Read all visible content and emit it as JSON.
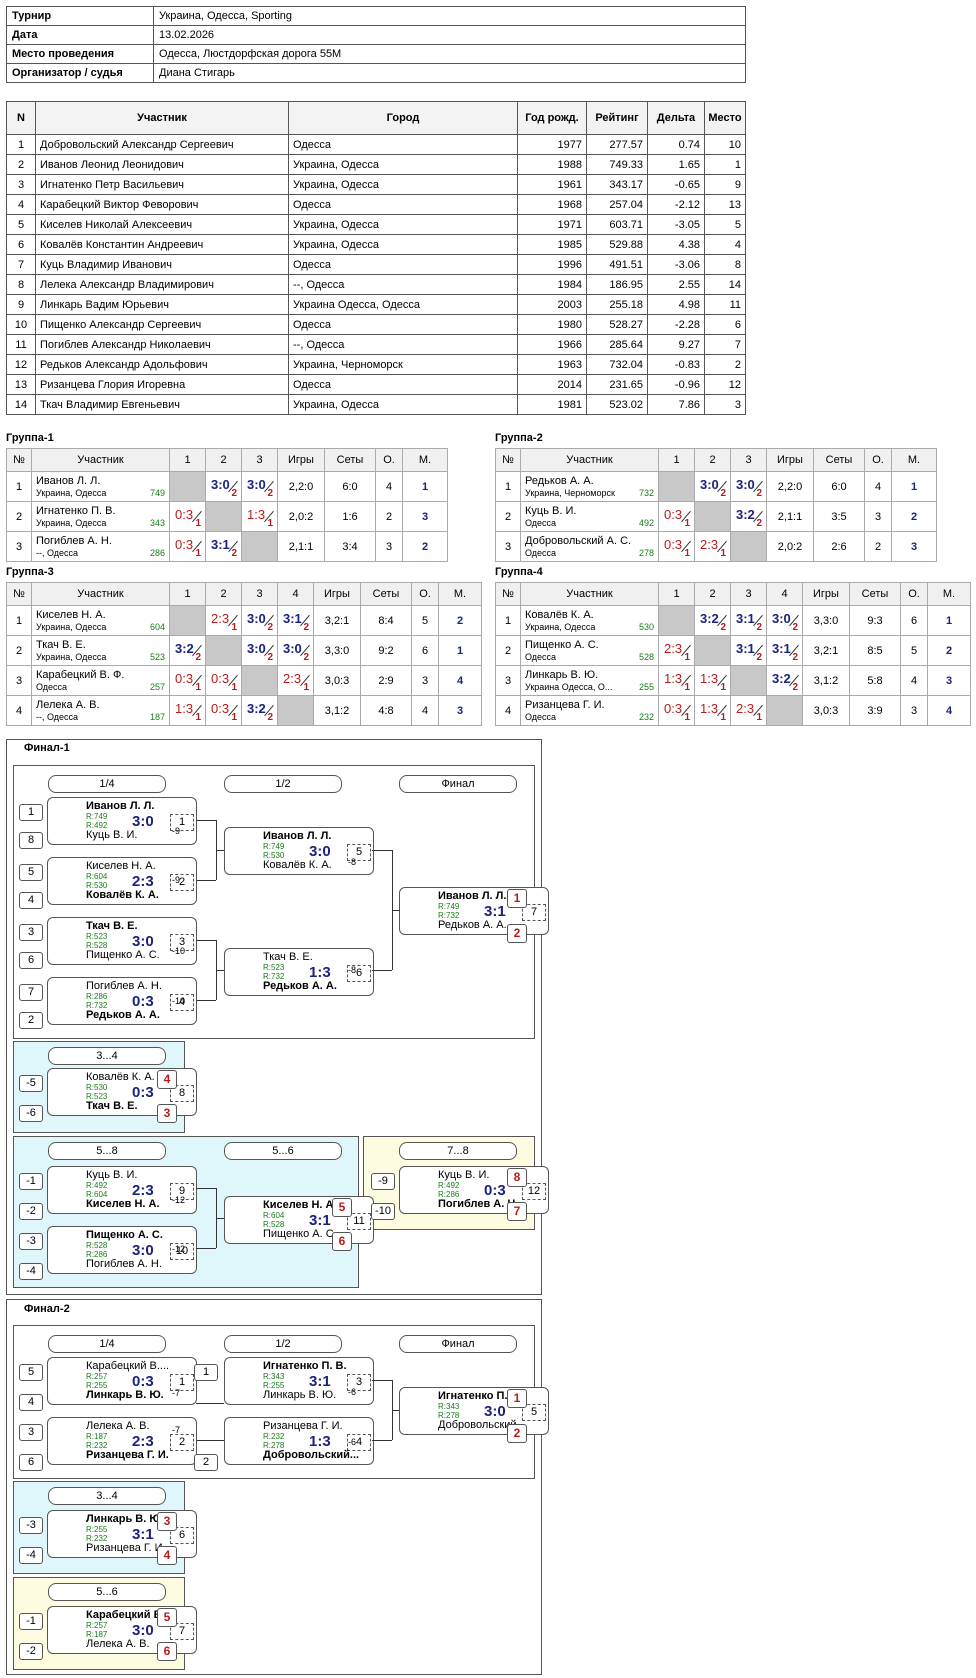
{
  "info": [
    {
      "k": "Турнир",
      "v": "Украина, Одесса, Sporting"
    },
    {
      "k": "Дата",
      "v": "13.02.2026"
    },
    {
      "k": "Место проведения",
      "v": "Одесса, Люстдорфская дорога 55М"
    },
    {
      "k": "Организатор / судья",
      "v": "Диана Стигарь"
    }
  ],
  "players_header": [
    "N",
    "Участник",
    "Город",
    "Год рожд.",
    "Рейтинг",
    "Дельта",
    "Место"
  ],
  "players": [
    [
      "1",
      "Добровольский Александр Сергеевич",
      "Одесса",
      "1977",
      "277.57",
      "0.74",
      "10"
    ],
    [
      "2",
      "Иванов Леонид Леонидович",
      "Украина, Одесса",
      "1988",
      "749.33",
      "1.65",
      "1"
    ],
    [
      "3",
      "Игнатенко Петр Васильевич",
      "Украина, Одесса",
      "1961",
      "343.17",
      "-0.65",
      "9"
    ],
    [
      "4",
      "Карабецкий Виктор Феворович",
      "Одесса",
      "1968",
      "257.04",
      "-2.12",
      "13"
    ],
    [
      "5",
      "Киселев Николай Алексеевич",
      "Украина, Одесса",
      "1971",
      "603.71",
      "-3.05",
      "5"
    ],
    [
      "6",
      "Ковалёв Константин Андреевич",
      "Украина, Одесса",
      "1985",
      "529.88",
      "4.38",
      "4"
    ],
    [
      "7",
      "Куць Владимир Иванович",
      "Одесса",
      "1996",
      "491.51",
      "-3.06",
      "8"
    ],
    [
      "8",
      "Лелека Александр Владимирович",
      "--, Одесса",
      "1984",
      "186.95",
      "2.55",
      "14"
    ],
    [
      "9",
      "Линкарь Вадим Юрьевич",
      "Украина Одесса, Одесса",
      "2003",
      "255.18",
      "4.98",
      "11"
    ],
    [
      "10",
      "Пищенко Александр Сергеевич",
      "Одесса",
      "1980",
      "528.27",
      "-2.28",
      "6"
    ],
    [
      "11",
      "Погиблев Александр Николаевич",
      "--, Одесса",
      "1966",
      "285.64",
      "9.27",
      "7"
    ],
    [
      "12",
      "Редьков Александр Адольфович",
      "Украина, Черноморск",
      "1963",
      "732.04",
      "-0.83",
      "2"
    ],
    [
      "13",
      "Ризанцева Глория Игоревна",
      "Одесса",
      "2014",
      "231.65",
      "-0.96",
      "12"
    ],
    [
      "14",
      "Ткач Владимир Евгеньевич",
      "Украина, Одесса",
      "1981",
      "523.02",
      "7.86",
      "3"
    ]
  ],
  "gh": {
    "n": "№",
    "p": "Участник",
    "games": "Игры",
    "sets": "Сеты",
    "o": "О.",
    "m": "М."
  },
  "groups": [
    {
      "title": "Группа-1",
      "cols": [
        "1",
        "2",
        "3"
      ],
      "rows": [
        {
          "n": "1",
          "name": "Иванов Л. Л.",
          "city": "Украина, Одесса",
          "r": "749",
          "cells": [
            null,
            [
              "3:0",
              "2",
              "w"
            ],
            [
              "3:0",
              "2",
              "w"
            ]
          ],
          "g": "2,2:0",
          "s": "6:0",
          "o": "4",
          "m": "1"
        },
        {
          "n": "2",
          "name": "Игнатенко П. В.",
          "city": "Украина, Одесса",
          "r": "343",
          "cells": [
            [
              "0:3",
              "1",
              "l"
            ],
            null,
            [
              "1:3",
              "1",
              "l"
            ]
          ],
          "g": "2,0:2",
          "s": "1:6",
          "o": "2",
          "m": "3"
        },
        {
          "n": "3",
          "name": "Погиблев А. Н.",
          "city": "--, Одесса",
          "r": "286",
          "cells": [
            [
              "0:3",
              "1",
              "l"
            ],
            [
              "3:1",
              "2",
              "w"
            ],
            null
          ],
          "g": "2,1:1",
          "s": "3:4",
          "o": "3",
          "m": "2"
        }
      ]
    },
    {
      "title": "Группа-2",
      "cols": [
        "1",
        "2",
        "3"
      ],
      "rows": [
        {
          "n": "1",
          "name": "Редьков А. А.",
          "city": "Украина, Черноморск",
          "r": "732",
          "cells": [
            null,
            [
              "3:0",
              "2",
              "w"
            ],
            [
              "3:0",
              "2",
              "w"
            ]
          ],
          "g": "2,2:0",
          "s": "6:0",
          "o": "4",
          "m": "1"
        },
        {
          "n": "2",
          "name": "Куць В. И.",
          "city": "Одесса",
          "r": "492",
          "cells": [
            [
              "0:3",
              "1",
              "l"
            ],
            null,
            [
              "3:2",
              "2",
              "w"
            ]
          ],
          "g": "2,1:1",
          "s": "3:5",
          "o": "3",
          "m": "2"
        },
        {
          "n": "3",
          "name": "Добровольский А. С.",
          "city": "Одесса",
          "r": "278",
          "cells": [
            [
              "0:3",
              "1",
              "l"
            ],
            [
              "2:3",
              "1",
              "l"
            ],
            null
          ],
          "g": "2,0:2",
          "s": "2:6",
          "o": "2",
          "m": "3"
        }
      ]
    },
    {
      "title": "Группа-3",
      "cols": [
        "1",
        "2",
        "3",
        "4"
      ],
      "rows": [
        {
          "n": "1",
          "name": "Киселев Н. А.",
          "city": "Украина, Одесса",
          "r": "604",
          "cells": [
            null,
            [
              "2:3",
              "1",
              "l"
            ],
            [
              "3:0",
              "2",
              "w"
            ],
            [
              "3:1",
              "2",
              "w"
            ]
          ],
          "g": "3,2:1",
          "s": "8:4",
          "o": "5",
          "m": "2"
        },
        {
          "n": "2",
          "name": "Ткач В. Е.",
          "city": "Украина, Одесса",
          "r": "523",
          "cells": [
            [
              "3:2",
              "2",
              "w"
            ],
            null,
            [
              "3:0",
              "2",
              "w"
            ],
            [
              "3:0",
              "2",
              "w"
            ]
          ],
          "g": "3,3:0",
          "s": "9:2",
          "o": "6",
          "m": "1"
        },
        {
          "n": "3",
          "name": "Карабецкий В. Ф.",
          "city": "Одесса",
          "r": "257",
          "cells": [
            [
              "0:3",
              "1",
              "l"
            ],
            [
              "0:3",
              "1",
              "l"
            ],
            null,
            [
              "2:3",
              "1",
              "l"
            ]
          ],
          "g": "3,0:3",
          "s": "2:9",
          "o": "3",
          "m": "4"
        },
        {
          "n": "4",
          "name": "Лелека А. В.",
          "city": "--, Одесса",
          "r": "187",
          "cells": [
            [
              "1:3",
              "1",
              "l"
            ],
            [
              "0:3",
              "1",
              "l"
            ],
            [
              "3:2",
              "2",
              "w"
            ],
            null
          ],
          "g": "3,1:2",
          "s": "4:8",
          "o": "4",
          "m": "3"
        }
      ]
    },
    {
      "title": "Группа-4",
      "cols": [
        "1",
        "2",
        "3",
        "4"
      ],
      "rows": [
        {
          "n": "1",
          "name": "Ковалёв К. А.",
          "city": "Украина, Одесса",
          "r": "530",
          "cells": [
            null,
            [
              "3:2",
              "2",
              "w"
            ],
            [
              "3:1",
              "2",
              "w"
            ],
            [
              "3:0",
              "2",
              "w"
            ]
          ],
          "g": "3,3:0",
          "s": "9:3",
          "o": "6",
          "m": "1"
        },
        {
          "n": "2",
          "name": "Пищенко А. С.",
          "city": "Одесса",
          "r": "528",
          "cells": [
            [
              "2:3",
              "1",
              "l"
            ],
            null,
            [
              "3:1",
              "2",
              "w"
            ],
            [
              "3:1",
              "2",
              "w"
            ]
          ],
          "g": "3,2:1",
          "s": "8:5",
          "o": "5",
          "m": "2"
        },
        {
          "n": "3",
          "name": "Линкарь В. Ю.",
          "city": "Украина Одесса, О...",
          "r": "255",
          "cells": [
            [
              "1:3",
              "1",
              "l"
            ],
            [
              "1:3",
              "1",
              "l"
            ],
            null,
            [
              "3:2",
              "2",
              "w"
            ]
          ],
          "g": "3,1:2",
          "s": "5:8",
          "o": "4",
          "m": "3"
        },
        {
          "n": "4",
          "name": "Ризанцева Г. И.",
          "city": "Одесса",
          "r": "232",
          "cells": [
            [
              "0:3",
              "1",
              "l"
            ],
            [
              "1:3",
              "1",
              "l"
            ],
            [
              "2:3",
              "1",
              "l"
            ],
            null
          ],
          "g": "3,0:3",
          "s": "3:9",
          "o": "3",
          "m": "4"
        }
      ]
    }
  ],
  "final1": {
    "title": "Финал-1",
    "labels": {
      "q": "1/4",
      "s": "1/2",
      "f": "Финал",
      "p34": "3...4",
      "p58": "5...8",
      "p56": "5...6",
      "p78": "7...8"
    },
    "matches": [
      {
        "a": "Иванов Л. Л.",
        "ra": "R:749",
        "b": "Куць В. И.",
        "rb": "R:492",
        "score": "3:0",
        "num": "1",
        "win": "a"
      },
      {
        "a": "Киселев Н. А.",
        "ra": "R:604",
        "b": "Ковалёв К. А.",
        "rb": "R:530",
        "score": "2:3",
        "num": "2",
        "win": "b"
      },
      {
        "a": "Ткач В. Е.",
        "ra": "R:523",
        "b": "Пищенко А. С.",
        "rb": "R:528",
        "score": "3:0",
        "num": "3",
        "win": "a"
      },
      {
        "a": "Погиблев А. Н.",
        "ra": "R:286",
        "b": "Редьков А. А.",
        "rb": "R:732",
        "score": "0:3",
        "num": "4",
        "win": "b"
      },
      {
        "a": "Иванов Л. Л.",
        "ra": "R:749",
        "b": "Ковалёв К. А.",
        "rb": "R:530",
        "score": "3:0",
        "num": "5",
        "win": "a"
      },
      {
        "a": "Ткач В. Е.",
        "ra": "R:523",
        "b": "Редьков А. А.",
        "rb": "R:732",
        "score": "1:3",
        "num": "6",
        "win": "b"
      },
      {
        "a": "Иванов Л. Л.",
        "ra": "R:749",
        "b": "Редьков А. А.",
        "rb": "R:732",
        "score": "3:1",
        "num": "7",
        "win": "a"
      },
      {
        "a": "Ковалёв К. А.",
        "ra": "R:530",
        "b": "Ткач В. Е.",
        "rb": "R:523",
        "score": "0:3",
        "num": "8",
        "win": "b"
      },
      {
        "a": "Куць В. И.",
        "ra": "R:492",
        "b": "Киселев Н. А.",
        "rb": "R:604",
        "score": "2:3",
        "num": "9",
        "win": "b"
      },
      {
        "a": "Пищенко А. С.",
        "ra": "R:528",
        "b": "Погиблев А. Н.",
        "rb": "R:286",
        "score": "3:0",
        "num": "10",
        "win": "a"
      },
      {
        "a": "Киселев Н. А.",
        "ra": "R:604",
        "b": "Пищенко А. С.",
        "rb": "R:528",
        "score": "3:1",
        "num": "11",
        "win": "a"
      },
      {
        "a": "Куць В. И.",
        "ra": "R:492",
        "b": "Погиблев А. Н.",
        "rb": "R:286",
        "score": "0:3",
        "num": "12",
        "win": "b"
      }
    ],
    "seeds": [
      "1",
      "8",
      "5",
      "4",
      "3",
      "6",
      "7",
      "2"
    ],
    "loser_refs": [
      "-9",
      "-9",
      "-10",
      "-10",
      "-8",
      "-8",
      "-12",
      "-12"
    ],
    "lseeds": [
      "-5",
      "-6",
      "-1",
      "-2",
      "-3",
      "-4",
      "-9",
      "-10"
    ],
    "places": [
      "1",
      "2",
      "4",
      "3",
      "5",
      "6",
      "8",
      "7"
    ]
  },
  "final2": {
    "title": "Финал-2",
    "labels": {
      "q": "1/4",
      "s": "1/2",
      "f": "Финал",
      "p34": "3...4",
      "p56": "5...6"
    },
    "matches": [
      {
        "a": "Карабецкий В....",
        "ra": "R:257",
        "b": "Линкарь В. Ю.",
        "rb": "R:255",
        "score": "0:3",
        "num": "1",
        "win": "b"
      },
      {
        "a": "Лелека А. В.",
        "ra": "R:187",
        "b": "Ризанцева Г. И.",
        "rb": "R:232",
        "score": "2:3",
        "num": "2",
        "win": "b"
      },
      {
        "a": "Игнатенко П. В.",
        "ra": "R:343",
        "b": "Линкарь В. Ю.",
        "rb": "R:255",
        "score": "3:1",
        "num": "3",
        "win": "a"
      },
      {
        "a": "Ризанцева Г. И.",
        "ra": "R:232",
        "b": "Добровольский...",
        "rb": "R:278",
        "score": "1:3",
        "num": "4",
        "win": "b"
      },
      {
        "a": "Игнатенко П. В.",
        "ra": "R:343",
        "b": "Добровольский...",
        "rb": "R:278",
        "score": "3:0",
        "num": "5",
        "win": "a"
      },
      {
        "a": "Линкарь В. Ю.",
        "ra": "R:255",
        "b": "Ризанцева Г. И.",
        "rb": "R:232",
        "score": "3:1",
        "num": "6",
        "win": "a"
      },
      {
        "a": "Карабецкий В....",
        "ra": "R:257",
        "b": "Лелека А. В.",
        "rb": "R:187",
        "score": "3:0",
        "num": "7",
        "win": "a"
      }
    ],
    "seeds": [
      "5",
      "4",
      "3",
      "6",
      "1",
      "2"
    ],
    "loser_refs": [
      "-7",
      "-7",
      "-6",
      "-6"
    ],
    "lseeds": [
      "-3",
      "-4",
      "-1",
      "-2"
    ],
    "places": [
      "1",
      "2",
      "3",
      "4",
      "5",
      "6"
    ]
  },
  "colors": {
    "blue": "#1a237e",
    "red": "#b71c1c",
    "green": "#1a7d1a",
    "cyan": "#dff7fb",
    "yellow": "#fdfbe0"
  }
}
